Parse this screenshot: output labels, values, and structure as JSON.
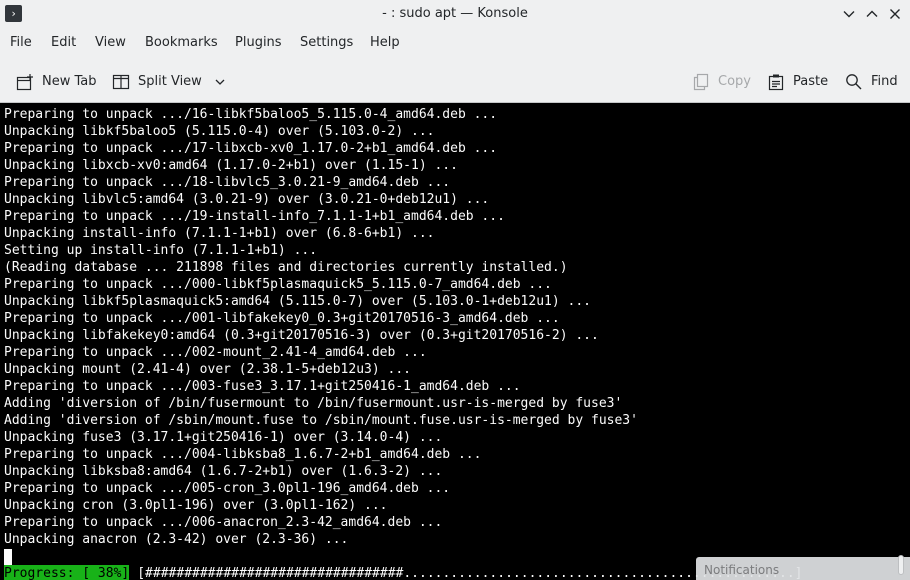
{
  "window": {
    "title": "- : sudo apt — Konsole",
    "app_icon": "terminal-icon"
  },
  "menubar": {
    "items": [
      "File",
      "Edit",
      "View",
      "Bookmarks",
      "Plugins",
      "Settings",
      "Help"
    ]
  },
  "toolbar": {
    "new_tab": "New Tab",
    "split_view": "Split View",
    "copy": "Copy",
    "paste": "Paste",
    "find": "Find"
  },
  "terminal": {
    "lines": [
      "Preparing to unpack .../16-libkf5baloo5_5.115.0-4_amd64.deb ...",
      "Unpacking libkf5baloo5 (5.115.0-4) over (5.103.0-2) ...",
      "Preparing to unpack .../17-libxcb-xv0_1.17.0-2+b1_amd64.deb ...",
      "Unpacking libxcb-xv0:amd64 (1.17.0-2+b1) over (1.15-1) ...",
      "Preparing to unpack .../18-libvlc5_3.0.21-9_amd64.deb ...",
      "Unpacking libvlc5:amd64 (3.0.21-9) over (3.0.21-0+deb12u1) ...",
      "Preparing to unpack .../19-install-info_7.1.1-1+b1_amd64.deb ...",
      "Unpacking install-info (7.1.1-1+b1) over (6.8-6+b1) ...",
      "Setting up install-info (7.1.1-1+b1) ...",
      "(Reading database ... 211898 files and directories currently installed.)",
      "Preparing to unpack .../000-libkf5plasmaquick5_5.115.0-7_amd64.deb ...",
      "Unpacking libkf5plasmaquick5:amd64 (5.115.0-7) over (5.103.0-1+deb12u1) ...",
      "Preparing to unpack .../001-libfakekey0_0.3+git20170516-3_amd64.deb ...",
      "Unpacking libfakekey0:amd64 (0.3+git20170516-3) over (0.3+git20170516-2) ...",
      "Preparing to unpack .../002-mount_2.41-4_amd64.deb ...",
      "Unpacking mount (2.41-4) over (2.38.1-5+deb12u3) ...",
      "Preparing to unpack .../003-fuse3_3.17.1+git250416-1_amd64.deb ...",
      "Adding 'diversion of /bin/fusermount to /bin/fusermount.usr-is-merged by fuse3'",
      "Adding 'diversion of /sbin/mount.fuse to /sbin/mount.fuse.usr-is-merged by fuse3'",
      "Unpacking fuse3 (3.17.1+git250416-1) over (3.14.0-4) ...",
      "Preparing to unpack .../004-libksba8_1.6.7-2+b1_amd64.deb ...",
      "Unpacking libksba8:amd64 (1.6.7-2+b1) over (1.6.3-2) ...",
      "Preparing to unpack .../005-cron_3.0pl1-196_amd64.deb ...",
      "Unpacking cron (3.0pl1-196) over (3.0pl1-162) ...",
      "Preparing to unpack .../006-anacron_2.3-42_amd64.deb ...",
      "Unpacking anacron (2.3-42) over (2.3-36) ..."
    ],
    "progress": {
      "label": "Progress: [ 38%]",
      "percent": 38,
      "bar": "[#################################..................................................]"
    }
  },
  "notification": {
    "text": "Notifications"
  }
}
